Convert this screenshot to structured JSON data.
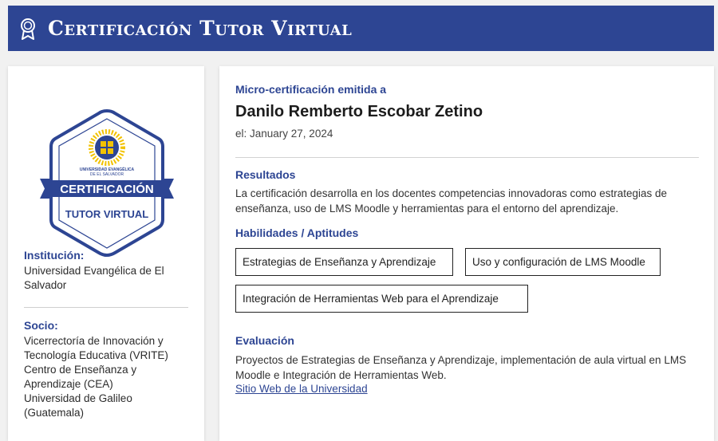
{
  "header": {
    "title": "Certificación Tutor Virtual",
    "icon": "award-ribbon-icon"
  },
  "badge": {
    "university_line1": "UNIVERSIDAD EVANGÉLICA",
    "university_line2": "DE EL SALVADOR",
    "line1": "CERTIFICACIÓN",
    "line2": "TUTOR VIRTUAL",
    "color": "#2d4593",
    "accent": "#f2c200"
  },
  "institution": {
    "label": "Institución:",
    "value": "Universidad Evangélica de El Salvador"
  },
  "partner": {
    "label": "Socio:",
    "lines": [
      "Vicerrectoría de Innovación y",
      "Tecnología Educativa (VRITE)",
      "Centro de Enseñanza y",
      "Aprendizaje (CEA)",
      "Universidad de Galileo",
      "(Guatemala)"
    ]
  },
  "cert": {
    "issued_label": "Micro-certificación emitida a",
    "recipient": "Danilo Remberto Escobar Zetino",
    "date": "el: January 27, 2024"
  },
  "results": {
    "title": "Resultados",
    "text": "La certificación desarrolla en los docentes competencias innovadoras como estrategias de enseñanza, uso de LMS Moodle y herramientas para el entorno del aprendizaje."
  },
  "skills": {
    "title": "Habilidades / Aptitudes",
    "items": [
      "Estrategias de Enseñanza y Aprendizaje",
      "Uso y configuración de LMS Moodle",
      "Integración de Herramientas Web para el Aprendizaje"
    ]
  },
  "evaluation": {
    "title": "Evaluación",
    "text": "Proyectos de Estrategias de Enseñanza y Aprendizaje, implementación de aula virtual en LMS Moodle e Integración de Herramientas Web.",
    "link_label": "Sitio Web de la Universidad"
  }
}
